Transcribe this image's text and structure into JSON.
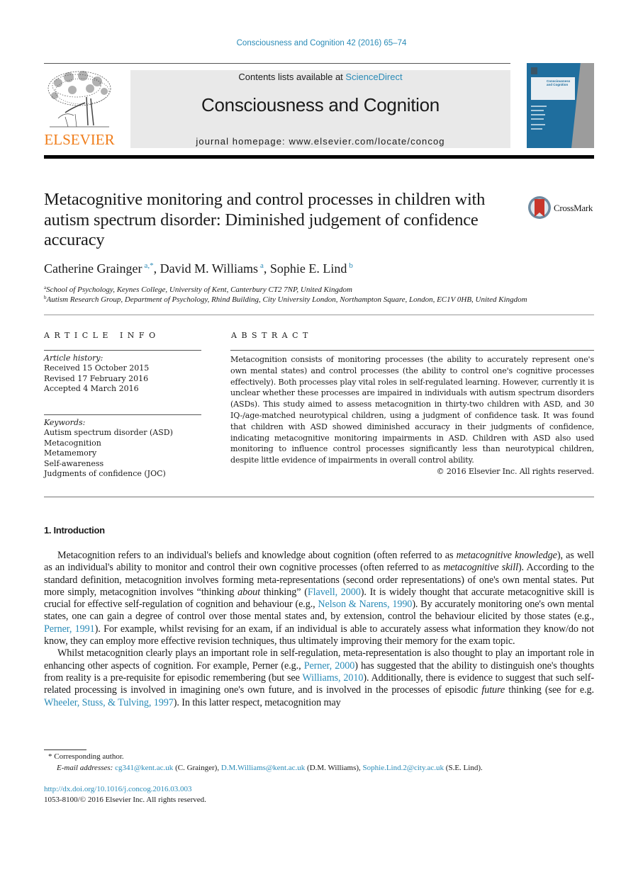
{
  "header": {
    "citation": "Consciousness and Cognition 42 (2016) 65–74",
    "contents_prefix": "Contents lists available at ",
    "contents_link": "ScienceDirect",
    "journal_name": "Consciousness and Cognition",
    "homepage": "journal homepage: www.elsevier.com/locate/concog",
    "publisher_logo_text": "ELSEVIER",
    "cover_title": "Consciousness and Cognition",
    "brand_orange": "#f07d1a",
    "link_color": "#2a8bb7"
  },
  "crossmark": {
    "label": "CrossMark"
  },
  "article": {
    "title": "Metacognitive monitoring and control processes in children with autism spectrum disorder: Diminished judgement of confidence accuracy",
    "authors": [
      {
        "name": "Catherine Grainger",
        "sup": "a,*"
      },
      {
        "name": "David M. Williams",
        "sup": "a"
      },
      {
        "name": "Sophie E. Lind",
        "sup": "b"
      }
    ],
    "affiliations": [
      {
        "sup": "a",
        "text": "School of Psychology, Keynes College, University of Kent, Canterbury CT2 7NP, United Kingdom"
      },
      {
        "sup": "b",
        "text": "Autism Research Group, Department of Psychology, Rhind Building, City University London, Northampton Square, London, EC1V 0HB, United Kingdom"
      }
    ]
  },
  "article_info": {
    "heading": "ARTICLE INFO",
    "history_label": "Article history:",
    "history": [
      "Received 15 October 2015",
      "Revised 17 February 2016",
      "Accepted 4 March 2016"
    ],
    "keywords_label": "Keywords:",
    "keywords": [
      "Autism spectrum disorder (ASD)",
      "Metacognition",
      "Metamemory",
      "Self-awareness",
      "Judgments of confidence (JOC)"
    ]
  },
  "abstract": {
    "heading": "ABSTRACT",
    "text": "Metacognition consists of monitoring processes (the ability to accurately represent one's own mental states) and control processes (the ability to control one's cognitive processes effectively). Both processes play vital roles in self-regulated learning. However, currently it is unclear whether these processes are impaired in individuals with autism spectrum disorders (ASDs). This study aimed to assess metacognition in thirty-two children with ASD, and 30 IQ-/age-matched neurotypical children, using a judgment of confidence task. It was found that children with ASD showed diminished accuracy in their judgments of confidence, indicating metacognitive monitoring impairments in ASD. Children with ASD also used monitoring to influence control processes significantly less than neurotypical children, despite little evidence of impairments in overall control ability.",
    "copyright": "© 2016 Elsevier Inc. All rights reserved."
  },
  "introduction": {
    "heading": "1. Introduction",
    "p1": {
      "s1": "Metacognition refers to an individual's beliefs and knowledge about cognition (often referred to as ",
      "i1": "metacognitive knowledge",
      "s2": "), as well as an individual's ability to monitor and control their own cognitive processes (often referred to as ",
      "i2": "metacognitive skill",
      "s3": "). According to the standard definition, metacognition involves forming meta-representations (second order representations) of one's own mental states. Put more simply, metacognition involves “thinking ",
      "i3": "about",
      "s4": " thinking” (",
      "c1": "Flavell, 2000",
      "s5": "). It is widely thought that accurate metacognitive skill is crucial for effective self-regulation of cognition and behaviour (e.g., ",
      "c2": "Nelson & Narens, 1990",
      "s6": "). By accurately monitoring one's own mental states, one can gain a degree of control over those mental states and, by extension, control the behaviour elicited by those states (e.g., ",
      "c3": "Perner, 1991",
      "s7": "). For example, whilst revising for an exam, if an individual is able to accurately assess what information they know/do not know, they can employ more effective revision techniques, thus ultimately improving their memory for the exam topic."
    },
    "p2": {
      "s1": "Whilst metacognition clearly plays an important role in self-regulation, meta-representation is also thought to play an important role in enhancing other aspects of cognition. For example, Perner (e.g., ",
      "c1": "Perner, 2000",
      "s2": ") has suggested that the ability to distinguish one's thoughts from reality is a pre-requisite for episodic remembering (but see ",
      "c2": "Williams, 2010",
      "s3": "). Additionally, there is evidence to suggest that such self-related processing is involved in imagining one's own future, and is involved in the processes of episodic ",
      "i1": "future",
      "s4": " thinking (see for e.g. ",
      "c3": "Wheeler, Stuss, & Tulving, 1997",
      "s5": "). In this latter respect, metacognition may"
    }
  },
  "footnotes": {
    "star": "*",
    "corresponding": "Corresponding author.",
    "email_label": "E-mail addresses:",
    "emails": [
      {
        "address": "cg341@kent.ac.uk",
        "owner": " (C. Grainger), "
      },
      {
        "address": "D.M.Williams@kent.ac.uk",
        "owner": " (D.M. Williams), "
      },
      {
        "address": "Sophie.Lind.2@city.ac.uk",
        "owner": " (S.E. Lind)."
      }
    ],
    "doi": "http://dx.doi.org/10.1016/j.concog.2016.03.003",
    "issn": "1053-8100/© 2016 Elsevier Inc. All rights reserved."
  }
}
